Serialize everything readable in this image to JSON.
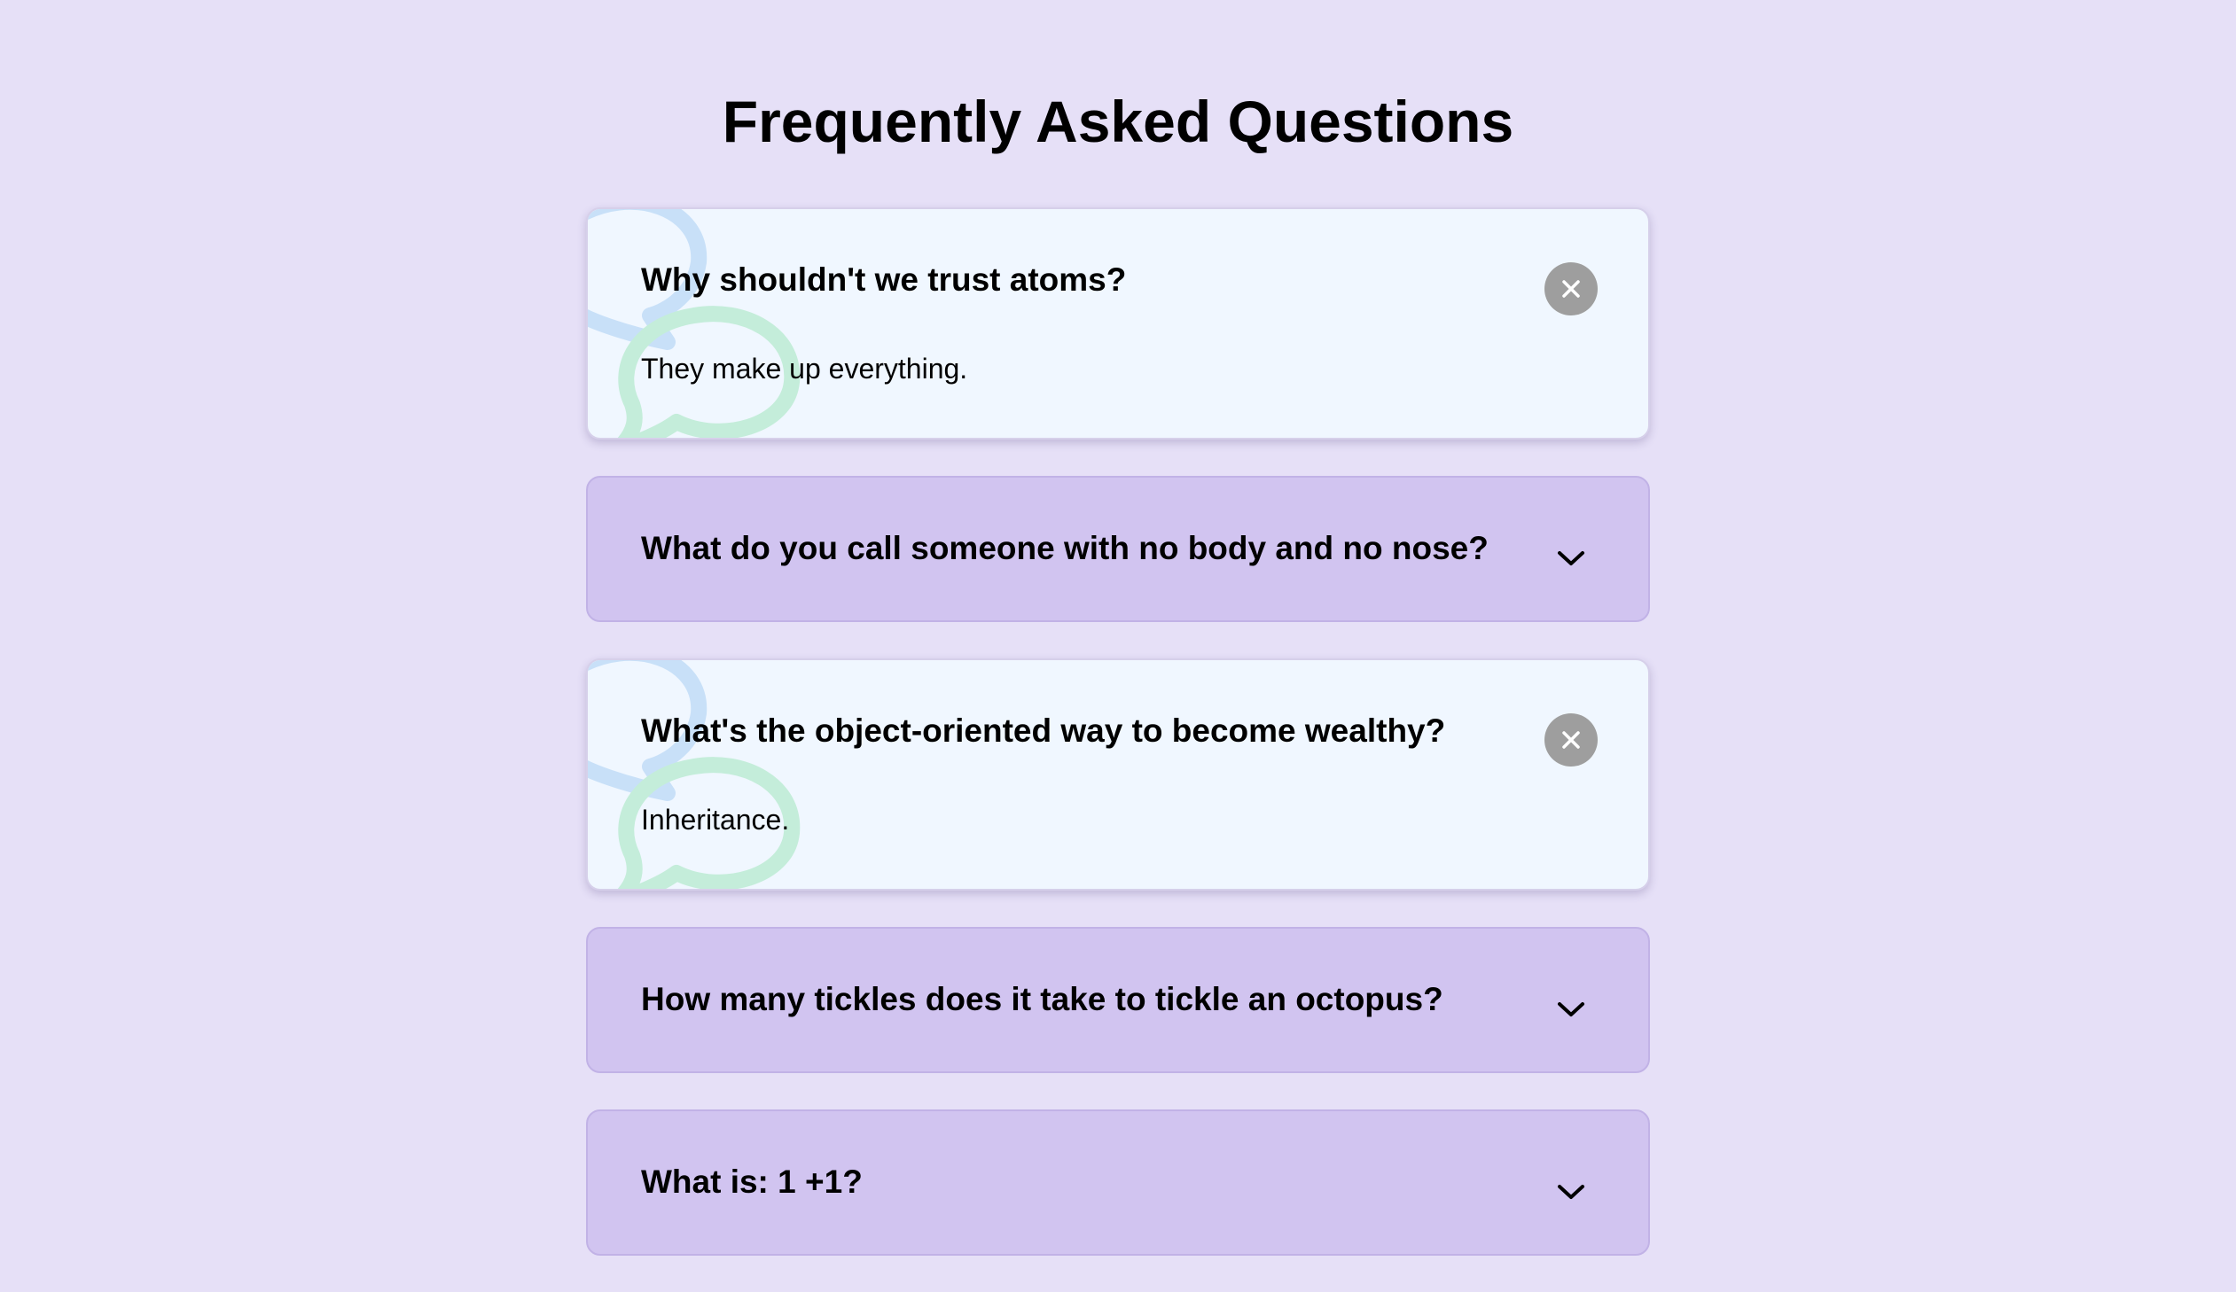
{
  "page": {
    "title": "Frequently Asked Questions",
    "background_color": "#e6e0f7"
  },
  "colors": {
    "open_card": "#f0f7ff",
    "closed_card": "#d1c4f0",
    "close_button": "#9e9e9e",
    "bubble_blue": "#c8e0f8",
    "bubble_green": "#c4edda"
  },
  "faqs": [
    {
      "question": "Why shouldn't we trust atoms?",
      "answer": "They make up everything.",
      "expanded": true,
      "toggle_icon": "close-icon"
    },
    {
      "question": "What do you call someone with no body and no nose?",
      "expanded": false,
      "toggle_icon": "chevron-down-icon"
    },
    {
      "question": "What's the object-oriented way to become wealthy?",
      "answer": "Inheritance.",
      "expanded": true,
      "toggle_icon": "close-icon"
    },
    {
      "question": "How many tickles does it take to tickle an octopus?",
      "expanded": false,
      "toggle_icon": "chevron-down-icon"
    },
    {
      "question": "What is: 1 +1?",
      "expanded": false,
      "toggle_icon": "chevron-down-icon"
    }
  ]
}
